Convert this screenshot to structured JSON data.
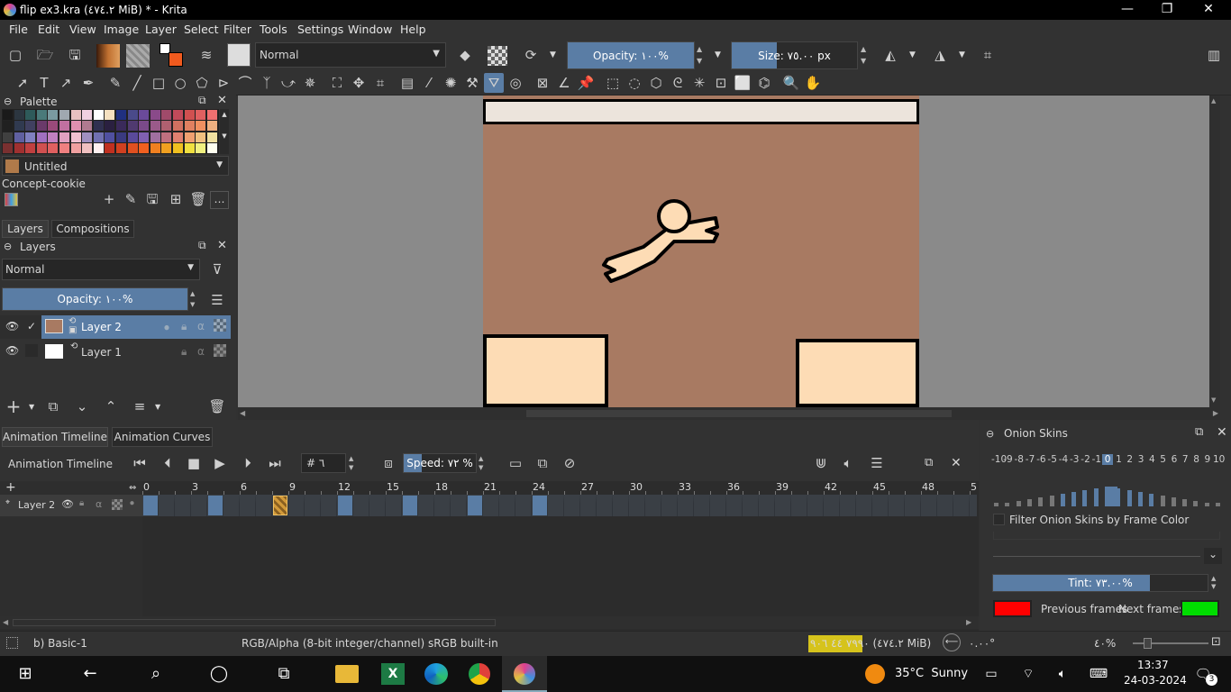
{
  "window": {
    "title": "flip ex3.kra (٤٧٤.٢ MiB) * - Krita",
    "minimize": "—",
    "restore": "❐",
    "close": "✕"
  },
  "menu": [
    "File",
    "Edit",
    "View",
    "Image",
    "Layer",
    "Select",
    "Filter",
    "Tools",
    "Settings",
    "Window",
    "Help"
  ],
  "toolbar": {
    "blend_mode": "Normal",
    "opacity_label": "Opacity: ١٠٠%",
    "size_label": "Size: ٧٥.٠٠ px"
  },
  "palette": {
    "header": "Palette",
    "name": "Untitled",
    "set_name": "Concept-cookie",
    "colors": [
      [
        "#1a1a1a",
        "#2c3640",
        "#2e5a5a",
        "#4a7a7a",
        "#7a9aa0",
        "#a0a8b0",
        "#e8c0c0",
        "#f0d0e0",
        "#ffffff",
        "#f5e0c0",
        "#203080",
        "#4a4a8a",
        "#6a4a9a",
        "#8a4a8a",
        "#a04a6a",
        "#c04a5a",
        "#d05050",
        "#e06060",
        "#f07070"
      ],
      [
        "#202020",
        "#303a50",
        "#404060",
        "#6a3a6a",
        "#9a4a7a",
        "#c070a0",
        "#e090b0",
        "#b07a90",
        "#303050",
        "#2a2040",
        "#3a2a5a",
        "#503a70",
        "#7a4a8a",
        "#9a5a8a",
        "#b06070",
        "#d07060",
        "#e08060",
        "#f09060",
        "#f0b080"
      ],
      [
        "#404040",
        "#6060a0",
        "#8080c0",
        "#a070c0",
        "#c080c0",
        "#e0a0c0",
        "#f0c0d0",
        "#a090c0",
        "#7070b0",
        "#5050a0",
        "#3a3a80",
        "#5a4a9a",
        "#8060b0",
        "#a070a0",
        "#c07080",
        "#e08070",
        "#f0a070",
        "#f0c080",
        "#f0e0a0"
      ],
      [
        "#7a3030",
        "#a03030",
        "#c04040",
        "#d05050",
        "#e06060",
        "#f08080",
        "#f0a0a0",
        "#f0c0c0",
        "#fff0f0",
        "#c03020",
        "#d04020",
        "#e05020",
        "#f06020",
        "#f08020",
        "#f0a020",
        "#f0c020",
        "#f0e040",
        "#f0f080",
        "#fffff0"
      ]
    ]
  },
  "layers_panel": {
    "tabs": [
      "Layers",
      "Compositions"
    ],
    "header": "Layers",
    "blend_mode": "Normal",
    "opacity_label": "Opacity: ١٠٠%",
    "layers": [
      {
        "name": "Layer 2",
        "selected": true
      },
      {
        "name": "Layer 1",
        "selected": false
      }
    ]
  },
  "timeline": {
    "tabs": [
      "Animation Timeline",
      "Animation Curves"
    ],
    "header": "Animation Timeline",
    "frame_field": "# ٦",
    "speed_label": "Speed: ٧٢ %",
    "ruler": [
      "0",
      "3",
      "6",
      "9",
      "12",
      "15",
      "18",
      "21",
      "24",
      "27",
      "30",
      "33",
      "36",
      "39",
      "42",
      "45",
      "48",
      "5"
    ],
    "layer_name": "Layer 2",
    "keyframes": [
      0,
      4,
      12,
      16,
      20,
      24
    ],
    "current_frame": 8
  },
  "onion": {
    "header": "Onion Skins",
    "numbers": [
      "-10",
      "-9",
      "-8",
      "-7",
      "-6",
      "-5",
      "-4",
      "-3",
      "-2",
      "-1",
      "0",
      "1",
      "2",
      "3",
      "4",
      "5",
      "6",
      "7",
      "8",
      "9",
      "10"
    ],
    "filter_label": "Filter Onion Skins by Frame Color",
    "tint_label": "Tint: ٧٣.٠٠%",
    "tint_fill": 0.73,
    "previous_label": "Previous frames",
    "next_label": "Next frames",
    "prev_color": "#ff0000",
    "next_color": "#00dd00"
  },
  "status": {
    "brush": "b) Basic-1",
    "color_space": "RGB/Alpha (8-bit integer/channel)  sRGB built-in",
    "memory": "٧٩٩٠ ٤٤ ٩٠٦ (٤٧٤.٢ MiB)",
    "rotation": "٠.٠٠°",
    "zoom": "٤٠%"
  },
  "taskbar": {
    "weather": "35°C  Sunny",
    "time": "13:37",
    "date": "24-03-2024",
    "notif": "3"
  },
  "colors": {
    "canvas_bg": "#a87a62",
    "block_fill": "#fddcb5",
    "top_bar": "#ece4dc",
    "accent": "#5a7da5",
    "current_frame": "#d29a3a"
  }
}
